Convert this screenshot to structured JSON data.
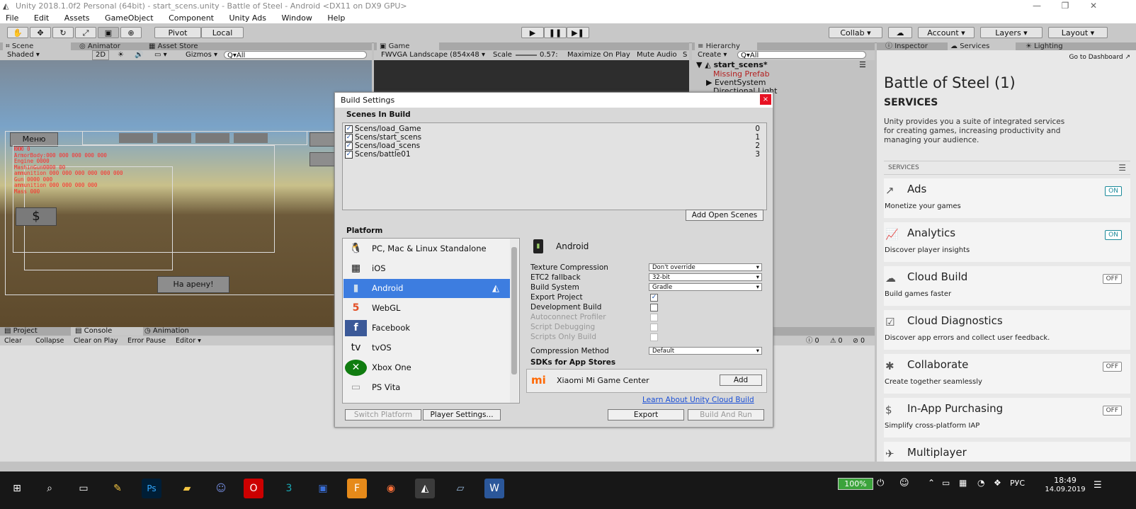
{
  "window": {
    "title": "Unity 2018.1.0f2 Personal (64bit) - start_scens.unity - Battle of Steel - Android <DX11 on DX9 GPU>",
    "min": "—",
    "max": "❐",
    "close": "✕"
  },
  "menu": [
    "File",
    "Edit",
    "Assets",
    "GameObject",
    "Component",
    "Unity Ads",
    "Window",
    "Help"
  ],
  "toolbar": {
    "pivot": "Pivot",
    "local": "Local",
    "collab": "Collab ▾",
    "account": "Account",
    "layers": "Layers",
    "layout": "Layout"
  },
  "scene_tabs": {
    "scene": "Scene",
    "animator": "Animator",
    "asset_store": "Asset Store",
    "shading": "Shaded",
    "mode2d": "2D",
    "gizmos": "Gizmos ▾",
    "search": "Q▾All"
  },
  "game_tabs": {
    "game": "Game",
    "resolution": "FWVGA Landscape (854x48",
    "scale_label": "Scale",
    "scale_value": "0.57:",
    "maximize": "Maximize On Play",
    "mute": "Mute Audio",
    "stats": "S"
  },
  "scene_overlay": {
    "menu_btn": "Меню",
    "dollar": "$",
    "arena_btn": "На арену!",
    "stats_lines": [
      "ЮЮЮ 0",
      "ArmorBody:000 000 000 000 000",
      "Engine 0000",
      "MashinGun0000 00",
      "ammunition 000 000 000 000 000 000",
      "Gun 0000 000",
      "ammunition 000 000 000 000",
      "Mass 000"
    ]
  },
  "hierarchy": {
    "tab": "Hierarchy",
    "create": "Create ▾",
    "search": "Q▾All",
    "scene": "start_scens*",
    "items": [
      "Missing Prefab",
      "EventSystem",
      "Directional Light"
    ]
  },
  "inspector_tabs": {
    "inspector": "Inspector",
    "services": "Services",
    "lighting": "Lighting"
  },
  "services": {
    "dashboard": "Go to Dashboard",
    "project": "Battle of Steel (1)",
    "heading": "SERVICES",
    "intro": "Unity provides you a suite of integrated services for creating games, increasing productivity and managing your audience.",
    "section": "SERVICES",
    "items": [
      {
        "name": "Ads",
        "desc": "Monetize your games",
        "state": "ON",
        "icon": "↗"
      },
      {
        "name": "Analytics",
        "desc": "Discover player insights",
        "state": "ON",
        "icon": "📈"
      },
      {
        "name": "Cloud Build",
        "desc": "Build games faster",
        "state": "OFF",
        "icon": "☁"
      },
      {
        "name": "Cloud Diagnostics",
        "desc": "Discover app errors and collect user feedback.",
        "state": "",
        "icon": "☑"
      },
      {
        "name": "Collaborate",
        "desc": "Create together seamlessly",
        "state": "OFF",
        "icon": "✱"
      },
      {
        "name": "In-App Purchasing",
        "desc": "Simplify cross-platform IAP",
        "state": "OFF",
        "icon": "$"
      },
      {
        "name": "Multiplayer",
        "desc": "",
        "state": "",
        "icon": "✈"
      }
    ]
  },
  "console": {
    "tabs": [
      "Project",
      "Console",
      "Animation"
    ],
    "buttons": [
      "Clear",
      "Collapse",
      "Clear on Play",
      "Error Pause",
      "Editor ▾"
    ],
    "counts": [
      "0",
      "0",
      "0"
    ]
  },
  "build": {
    "title": "Build Settings",
    "close": "×",
    "scenes_label": "Scenes In Build",
    "scenes": [
      {
        "path": "Scens/load_Game",
        "index": "0"
      },
      {
        "path": "Scens/start_scens",
        "index": "1"
      },
      {
        "path": "Scens/load_scens",
        "index": "2"
      },
      {
        "path": "Scens/battle01",
        "index": "3"
      }
    ],
    "add_open": "Add Open Scenes",
    "platform_label": "Platform",
    "platforms": [
      {
        "name": "PC, Mac & Linux Standalone",
        "icon": "🐧"
      },
      {
        "name": "iOS",
        "icon": "▦"
      },
      {
        "name": "Android",
        "icon": "▮"
      },
      {
        "name": "WebGL",
        "icon": "5"
      },
      {
        "name": "Facebook",
        "icon": "f"
      },
      {
        "name": "tvOS",
        "icon": "tv"
      },
      {
        "name": "Xbox One",
        "icon": "✕"
      },
      {
        "name": "PS Vita",
        "icon": "▭"
      }
    ],
    "selected": "Android",
    "settings": [
      {
        "label": "Texture Compression",
        "type": "select",
        "value": "Don't override"
      },
      {
        "label": "ETC2 fallback",
        "type": "select",
        "value": "32-bit"
      },
      {
        "label": "Build System",
        "type": "select",
        "value": "Gradle"
      },
      {
        "label": "Export Project",
        "type": "check",
        "value": "✓"
      },
      {
        "label": "Development Build",
        "type": "check",
        "value": ""
      },
      {
        "label": "Autoconnect Profiler",
        "type": "check",
        "value": "",
        "disabled": true
      },
      {
        "label": "Script Debugging",
        "type": "check",
        "value": "",
        "disabled": true
      },
      {
        "label": "Scripts Only Build",
        "type": "check",
        "value": "",
        "disabled": true
      },
      {
        "label": "Compression Method",
        "type": "select",
        "value": "Default"
      }
    ],
    "sdks_label": "SDKs for App Stores",
    "sdk": {
      "name": "Xiaomi Mi Game Center",
      "add": "Add",
      "logo": "mi"
    },
    "learn": "Learn About Unity Cloud Build",
    "switch": "Switch Platform",
    "player_settings": "Player Settings...",
    "export": "Export",
    "build_and_run": "Build And Run"
  },
  "taskbar": {
    "battery": "100%",
    "lang": "РУС",
    "time": "18:49",
    "date": "14.09.2019"
  }
}
